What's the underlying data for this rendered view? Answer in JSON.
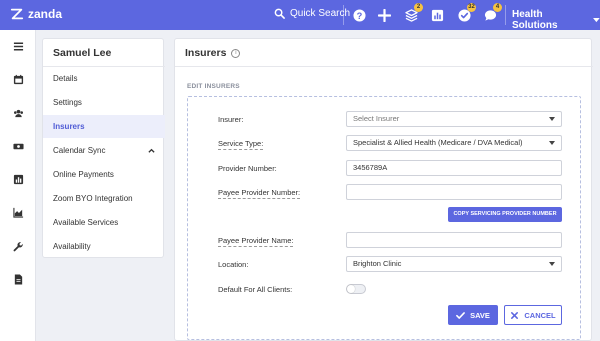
{
  "brand": {
    "name": "zanda",
    "accent": "#5c67e0"
  },
  "header": {
    "search_label": "Quick Search",
    "badges": {
      "updates": "2",
      "tasks": "32",
      "messages": "4"
    },
    "org_name": "Health Solutions"
  },
  "submenu": {
    "title": "Samuel Lee",
    "items": [
      {
        "label": "Details"
      },
      {
        "label": "Settings"
      },
      {
        "label": "Insurers"
      },
      {
        "label": "Calendar Sync"
      },
      {
        "label": "Online Payments"
      },
      {
        "label": "Zoom BYO Integration"
      },
      {
        "label": "Available Services"
      },
      {
        "label": "Availability"
      }
    ]
  },
  "main": {
    "title": "Insurers",
    "section_title": "EDIT INSURERS",
    "form": {
      "insurer_label": "Insurer:",
      "insurer_placeholder": "Select Insurer",
      "service_type_label": "Service Type:",
      "service_type_value": "Specialist & Allied Health (Medicare / DVA Medical)",
      "provider_number_label": "Provider Number:",
      "provider_number_value": "3456789A",
      "payee_provider_number_label": "Payee Provider Number:",
      "payee_provider_number_value": "",
      "copy_button_label": "COPY SERVICING PROVIDER NUMBER",
      "payee_provider_name_label": "Payee Provider Name:",
      "payee_provider_name_value": "",
      "location_label": "Location:",
      "location_value": "Brighton Clinic",
      "default_label": "Default For All Clients:",
      "default_on": false,
      "save_label": "SAVE",
      "cancel_label": "CANCEL"
    }
  }
}
